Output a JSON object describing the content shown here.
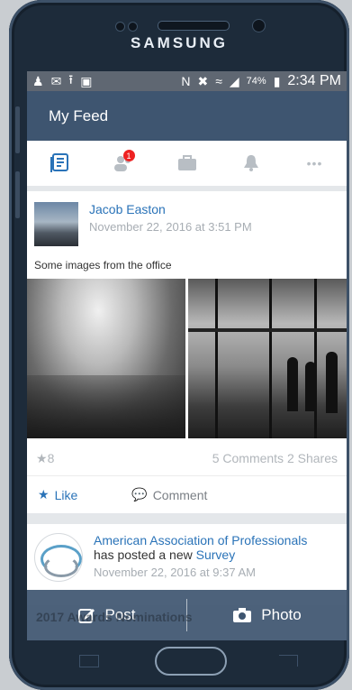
{
  "device": {
    "brand": "SAMSUNG"
  },
  "status_bar": {
    "battery": "74%",
    "time": "2:34 PM"
  },
  "app_bar": {
    "title": "My Feed"
  },
  "tabs": [
    {
      "name": "feed",
      "icon": "feed-icon",
      "active": true
    },
    {
      "name": "people",
      "icon": "people-icon",
      "badge": "1"
    },
    {
      "name": "jobs",
      "icon": "briefcase-icon"
    },
    {
      "name": "notifications",
      "icon": "bell-icon"
    },
    {
      "name": "more",
      "icon": "more-icon"
    }
  ],
  "post": {
    "author": "Jacob Easton",
    "date": "November 22, 2016 at 3:51 PM",
    "caption": "Some images from the office",
    "likes": "8",
    "comments": "5 Comments",
    "shares": "2 Shares",
    "like_label": "Like",
    "comment_label": "Comment"
  },
  "post2": {
    "author": "American Association of Professionals",
    "text_prefix": "has posted a new",
    "link": "Survey",
    "date": "November 22, 2016 at 9:37 AM",
    "preview": "2017 Awards Nominations"
  },
  "bottom_bar": {
    "post_label": "Post",
    "photo_label": "Photo"
  },
  "colors": {
    "app_bar": "#3e5570",
    "accent": "#2a73b8",
    "badge": "#e22222"
  }
}
